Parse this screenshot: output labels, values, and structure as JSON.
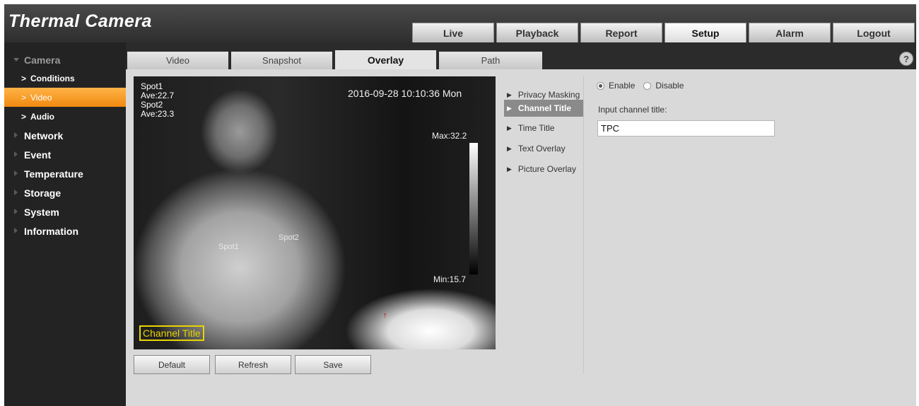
{
  "app": {
    "title": "Thermal Camera"
  },
  "main_nav": [
    {
      "label": "Live"
    },
    {
      "label": "Playback"
    },
    {
      "label": "Report"
    },
    {
      "label": "Setup",
      "active": true
    },
    {
      "label": "Alarm"
    },
    {
      "label": "Logout"
    }
  ],
  "sidebar": {
    "camera": "Camera",
    "camera_children": [
      "Conditions",
      "Video",
      "Audio"
    ],
    "sections": [
      "Network",
      "Event",
      "Temperature",
      "Storage",
      "System",
      "Information"
    ],
    "active_child": "Video"
  },
  "sub_tabs": [
    "Video",
    "Snapshot",
    "Overlay",
    "Path"
  ],
  "active_sub_tab": "Overlay",
  "help": "?",
  "preview": {
    "spots_text": "Spot1\nAve:22.7\nSpot2\nAve:23.3",
    "datetime": "2016-09-28 10:10:36 Mon",
    "max": "Max:32.2",
    "min": "Min:15.7",
    "spot_mark_1": "Spot1",
    "spot_mark_2": "Spot2",
    "arrow": "↑",
    "channel_title": "Channel Title"
  },
  "buttons": {
    "default": "Default",
    "refresh": "Refresh",
    "save": "Save"
  },
  "overlay_menu": [
    "Privacy Masking",
    "Channel Title",
    "Time Title",
    "Text Overlay",
    "Picture Overlay"
  ],
  "active_overlay": "Channel Title",
  "settings": {
    "enable_label": "Enable",
    "disable_label": "Disable",
    "selected": "Enable",
    "input_label": "Input channel title:",
    "input_value": "TPC"
  }
}
